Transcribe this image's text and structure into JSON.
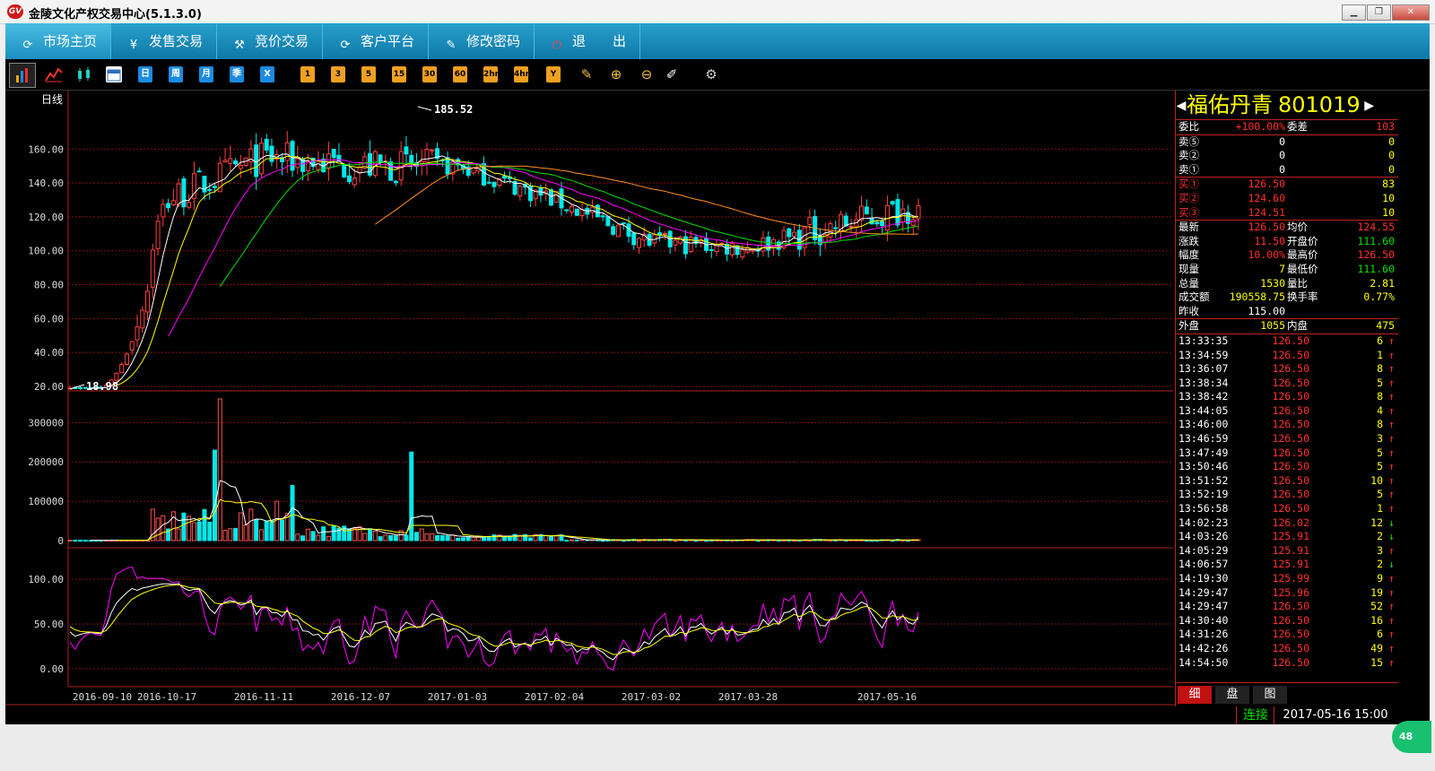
{
  "window": {
    "title": "金陵文化产权交易中心(5.1.3.0)",
    "logo_text": "GV"
  },
  "menu": [
    {
      "label": "市场主页",
      "icon": "refresh-circle-icon",
      "glyph": "⟳",
      "active": true
    },
    {
      "label": "发售交易",
      "icon": "yen-icon",
      "glyph": "¥",
      "active": false
    },
    {
      "label": "竞价交易",
      "icon": "hammer-icon",
      "glyph": "⚒",
      "active": false
    },
    {
      "label": "客户平台",
      "icon": "refresh-circle-icon",
      "glyph": "⟳",
      "active": false
    },
    {
      "label": "修改密码",
      "icon": "key-icon",
      "glyph": "✎",
      "active": false
    },
    {
      "label": "退　　出",
      "icon": "power-icon",
      "glyph": "⏻",
      "active": false
    }
  ],
  "toolbar": {
    "period_buttons": [
      "日",
      "周",
      "月",
      "季",
      "X"
    ],
    "minute_buttons": [
      "1",
      "3",
      "5",
      "15",
      "30",
      "60",
      "2hr",
      "4hr",
      "Y"
    ]
  },
  "chart": {
    "period_label": "日线",
    "price_high_label": "185.52",
    "price_low_label": "18.98",
    "price_axis": [
      "160.00",
      "140.00",
      "120.00",
      "100.00",
      "80.00",
      "60.00",
      "40.00",
      "20.00"
    ],
    "volume_axis": [
      "300000",
      "200000",
      "100000",
      "0"
    ],
    "osc_axis": [
      "100.00",
      "50.00",
      "0.00"
    ],
    "date_axis": [
      "2016-09-10",
      "2016-10-17",
      "2016-11-11",
      "2016-12-07",
      "2017-01-03",
      "2017-02-04",
      "2017-03-02",
      "2017-03-28",
      "2017-05-16"
    ]
  },
  "chart_data": {
    "type": "candlestick",
    "price_range": [
      18.98,
      185.52
    ],
    "price_ylim": [
      20,
      185
    ],
    "volume_ylim": [
      0,
      360000
    ],
    "osc_ylim": [
      -10,
      130
    ],
    "key_points": [
      {
        "date": "2016-09-10",
        "close": 18.98
      },
      {
        "date": "2016-10-17",
        "close": 130
      },
      {
        "date": "2016-11-11",
        "close": 155
      },
      {
        "date": "2016-12-07",
        "close": 150
      },
      {
        "date": "2017-01-03",
        "close": 150
      },
      {
        "date": "2017-02-04",
        "close": 130
      },
      {
        "date": "2017-03-02",
        "close": 105
      },
      {
        "date": "2017-03-28",
        "close": 102
      },
      {
        "date": "2017-05-16",
        "close": 126.5
      }
    ]
  },
  "quote": {
    "name": "福佑丹青",
    "code": "801019",
    "weibi_label": "委比",
    "weibi": "+100.00%",
    "weicha_label": "委差",
    "weicha": "103",
    "sells": [
      {
        "label": "卖⑤",
        "price": "0",
        "vol": "0"
      },
      {
        "label": "卖②",
        "price": "0",
        "vol": "0"
      },
      {
        "label": "卖①",
        "price": "0",
        "vol": "0"
      }
    ],
    "buys": [
      {
        "label": "买①",
        "price": "126.50",
        "vol": "83"
      },
      {
        "label": "买②",
        "price": "124.60",
        "vol": "10"
      },
      {
        "label": "买③",
        "price": "124.51",
        "vol": "10"
      }
    ],
    "stats": [
      {
        "l1": "最新",
        "v1": "126.50",
        "l2": "均价",
        "v2": "124.55"
      },
      {
        "l1": "涨跌",
        "v1": "11.50",
        "l2": "开盘价",
        "v2": "111.60"
      },
      {
        "l1": "幅度",
        "v1": "10.00%",
        "l2": "最高价",
        "v2": "126.50"
      },
      {
        "l1": "现量",
        "v1": "7",
        "l2": "最低价",
        "v2": "111.60"
      },
      {
        "l1": "总量",
        "v1": "1530",
        "l2": "量比",
        "v2": "2.81"
      },
      {
        "l1": "成交额",
        "v1": "190558.75",
        "l2": "换手率",
        "v2": "0.77%"
      }
    ],
    "prev_close_label": "昨收",
    "prev_close": "115.00",
    "outer_label": "外盘",
    "outer": "1055",
    "inner_label": "内盘",
    "inner": "475",
    "ticks": [
      {
        "t": "13:33:35",
        "p": "126.50",
        "v": "6",
        "d": "↑"
      },
      {
        "t": "13:34:59",
        "p": "126.50",
        "v": "1",
        "d": "↑"
      },
      {
        "t": "13:36:07",
        "p": "126.50",
        "v": "8",
        "d": "↑"
      },
      {
        "t": "13:38:34",
        "p": "126.50",
        "v": "5",
        "d": "↑"
      },
      {
        "t": "13:38:42",
        "p": "126.50",
        "v": "8",
        "d": "↑"
      },
      {
        "t": "13:44:05",
        "p": "126.50",
        "v": "4",
        "d": "↑"
      },
      {
        "t": "13:46:00",
        "p": "126.50",
        "v": "8",
        "d": "↑"
      },
      {
        "t": "13:46:59",
        "p": "126.50",
        "v": "3",
        "d": "↑"
      },
      {
        "t": "13:47:49",
        "p": "126.50",
        "v": "5",
        "d": "↑"
      },
      {
        "t": "13:50:46",
        "p": "126.50",
        "v": "5",
        "d": "↑"
      },
      {
        "t": "13:51:52",
        "p": "126.50",
        "v": "10",
        "d": "↑"
      },
      {
        "t": "13:52:19",
        "p": "126.50",
        "v": "5",
        "d": "↑"
      },
      {
        "t": "13:56:58",
        "p": "126.50",
        "v": "1",
        "d": "↑"
      },
      {
        "t": "14:02:23",
        "p": "126.02",
        "v": "12",
        "d": "↓"
      },
      {
        "t": "14:03:26",
        "p": "125.91",
        "v": "2",
        "d": "↓"
      },
      {
        "t": "14:05:29",
        "p": "125.91",
        "v": "3",
        "d": "↑"
      },
      {
        "t": "14:06:57",
        "p": "125.91",
        "v": "2",
        "d": "↓"
      },
      {
        "t": "14:19:30",
        "p": "125.99",
        "v": "9",
        "d": "↑"
      },
      {
        "t": "14:29:47",
        "p": "125.96",
        "v": "19",
        "d": "↑"
      },
      {
        "t": "14:29:47",
        "p": "126.50",
        "v": "52",
        "d": "↑"
      },
      {
        "t": "14:30:40",
        "p": "126.50",
        "v": "16",
        "d": "↑"
      },
      {
        "t": "14:31:26",
        "p": "126.50",
        "v": "6",
        "d": "↑"
      },
      {
        "t": "14:42:26",
        "p": "126.50",
        "v": "49",
        "d": "↑"
      },
      {
        "t": "14:54:50",
        "p": "126.50",
        "v": "15",
        "d": "↑"
      }
    ],
    "tabs": [
      "细",
      "盘",
      "图"
    ]
  },
  "status": {
    "connection": "连接",
    "datetime": "2017-05-16 15:00"
  },
  "badge": {
    "text": "48"
  }
}
